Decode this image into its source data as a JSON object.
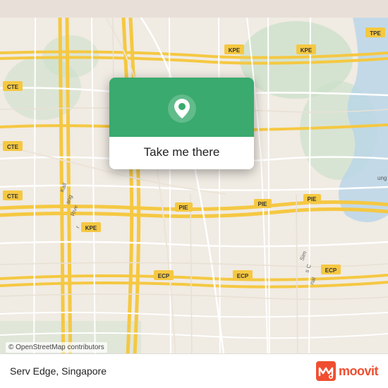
{
  "map": {
    "alt": "Singapore road map"
  },
  "card": {
    "button_label": "Take me there",
    "icon_name": "location-pin-icon"
  },
  "bottom_bar": {
    "location_name": "Serv Edge, Singapore",
    "moovit_label": "moovit"
  },
  "attribution": {
    "text": "© OpenStreetMap contributors"
  },
  "road_labels": [
    "CTE",
    "CTE",
    "CTE",
    "KPE",
    "KPE",
    "KPE",
    "PIE",
    "PIE",
    "PIE",
    "ECP",
    "ECP",
    "ECP"
  ]
}
